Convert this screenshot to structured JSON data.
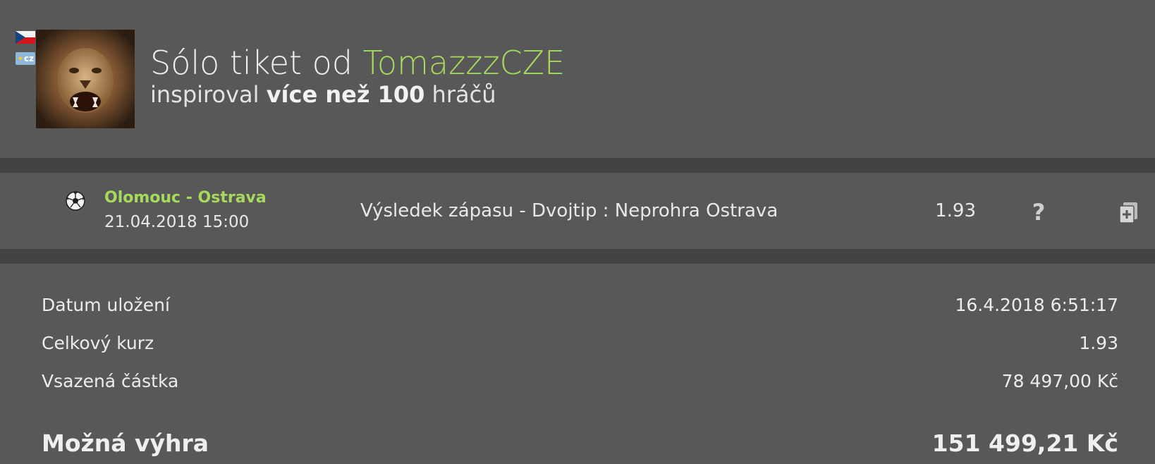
{
  "header": {
    "title_prefix": "Sólo tiket od",
    "username": "TomazzzCZE",
    "subtitle_prefix": "inspiroval",
    "subtitle_bold": "více než 100",
    "subtitle_suffix": "hráčů",
    "country_badge": "cz",
    "accent_color": "#a7d95c"
  },
  "bet": {
    "sport_icon": "soccer-ball-icon",
    "match": "Olomouc - Ostrava",
    "datetime": "21.04.2018 15:00",
    "description": "Výsledek zápasu - Dvojtip : Neprohra Ostrava",
    "odds": "1.93",
    "help_icon": "?",
    "copy_icon": "copy-ticket-icon"
  },
  "summary": {
    "rows": [
      {
        "label": "Datum uložení",
        "value": "16.4.2018 6:51:17"
      },
      {
        "label": "Celkový kurz",
        "value": "1.93"
      },
      {
        "label": "Vsazená částka",
        "value": "78 497,00 Kč"
      }
    ],
    "win_label": "Možná výhra",
    "win_value": "151 499,21 Kč"
  }
}
